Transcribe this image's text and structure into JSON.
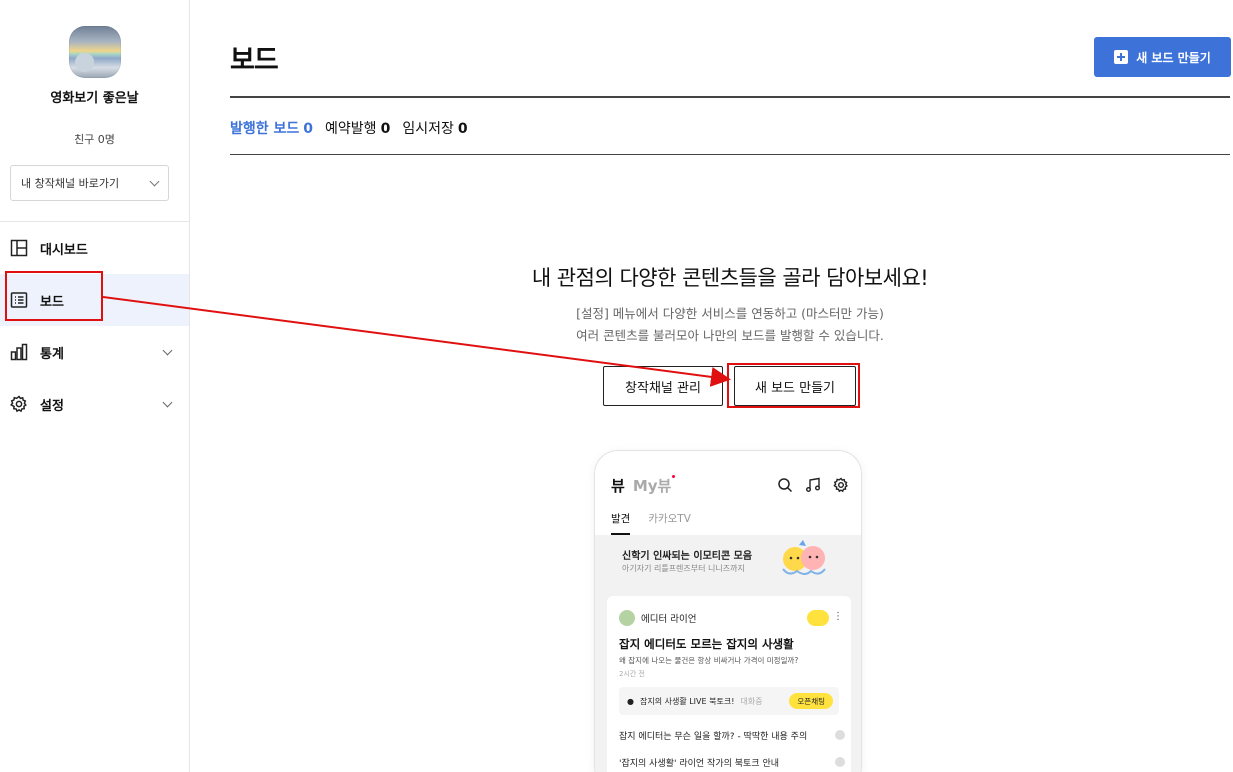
{
  "sidebar": {
    "profile_name": "영화보기 좋은날",
    "friends": "친구 0명",
    "channel_select": "내 창작채널 바로가기",
    "nav": [
      {
        "label": "대시보드",
        "icon": "dashboard-icon"
      },
      {
        "label": "보드",
        "icon": "board-list-icon",
        "active": true
      },
      {
        "label": "통계",
        "icon": "bar-chart-icon"
      },
      {
        "label": "설정",
        "icon": "gear-icon"
      }
    ]
  },
  "header": {
    "title": "보드",
    "new_board_button": "새 보드 만들기"
  },
  "tabs": [
    {
      "label": "발행한 보드",
      "count": "0",
      "active": true
    },
    {
      "label": "예약발행",
      "count": "0"
    },
    {
      "label": "임시저장",
      "count": "0"
    }
  ],
  "empty_state": {
    "title": "내 관점의 다양한 콘텐츠들을 골라 담아보세요!",
    "desc_line1": "[설정] 메뉴에서 다양한 서비스를 연동하고 (마스터만 가능)",
    "desc_line2": "여러 콘텐츠를 불러모아 나만의 보드를 발행할 수 있습니다.",
    "manage_button": "창작채널 관리",
    "new_button": "새 보드 만들기"
  },
  "phone": {
    "brand": "뷰",
    "my": "My뷰",
    "tab_discover": "발견",
    "tab_kakaotv": "카카오TV",
    "banner_title": "신학기 인싸되는 이모티콘 모음",
    "banner_sub": "아기자기 리틀프렌즈부터 니니즈까지",
    "editor": "에디터 라이언",
    "card_title": "잡지 에디터도 모르는 잡지의 사생활",
    "card_desc": "왜 잡지에 나오는 물건은 항상 비싸거나 가격이 미정일까?",
    "card_time": "2시간 전",
    "live_text": "잡지의 사생활 LIVE 북토크!",
    "live_sub": "대화중",
    "open_chat": "오픈채팅",
    "row1": "잡지 에디터는 무슨 일을 할까? - 딱딱한 내용 주의",
    "row2": "'잡지의 사생활' 라이언 작가의 북토크 안내"
  },
  "colors": {
    "accent": "#3d73d9",
    "annotation": "#e01010",
    "kakao_yellow": "#ffe23d"
  }
}
